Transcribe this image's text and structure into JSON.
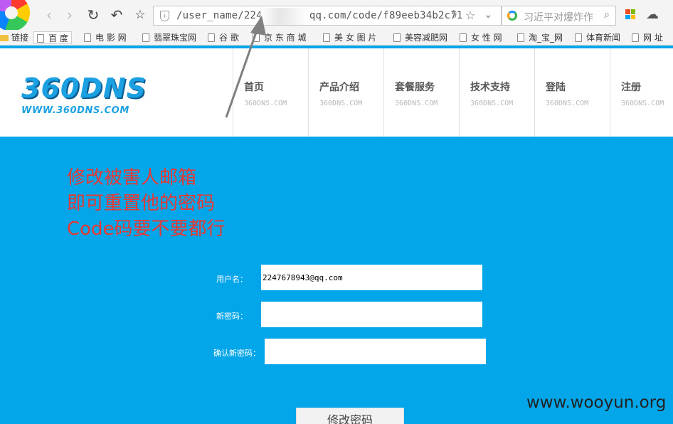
{
  "browser": {
    "url_prefix": "/user_name/224",
    "url_suffix": "qq.com/code/f89eeb34b2c71",
    "search_placeholder": "习近平对爆炸作"
  },
  "bookmarks": [
    {
      "label": "链接"
    },
    {
      "label": "百 度"
    },
    {
      "label": "电 影 网"
    },
    {
      "label": "翡翠珠宝网"
    },
    {
      "label": "谷 歌"
    },
    {
      "label": "京 东 商 城"
    },
    {
      "label": "美 女 图 片"
    },
    {
      "label": "美容减肥网"
    },
    {
      "label": "女 性 网"
    },
    {
      "label": "淘_宝_网"
    },
    {
      "label": "体育新闻"
    },
    {
      "label": "网 址"
    }
  ],
  "site": {
    "brand": "360DNS",
    "brand_url": "WWW.360DNS.COM",
    "nav": [
      {
        "title": "首页",
        "sub": "360DNS.COM"
      },
      {
        "title": "产品介绍",
        "sub": "360DNS.COM"
      },
      {
        "title": "套餐服务",
        "sub": "360DNS.COM"
      },
      {
        "title": "技术支持",
        "sub": "360DNS.COM"
      },
      {
        "title": "登陆",
        "sub": "360DNS.COM"
      },
      {
        "title": "注册",
        "sub": "360DNS.COM"
      }
    ]
  },
  "annotation": {
    "line1": "修改被害人邮箱",
    "line2": "即可重置他的密码",
    "line3": "Code码要不要都行"
  },
  "form": {
    "username_label": "用户名：",
    "username_value": "2247678943@qq.com",
    "new_password_label": "新密码：",
    "confirm_password_label": "确认新密码：",
    "submit_label": "修改密码"
  },
  "watermark": "www.wooyun.org"
}
